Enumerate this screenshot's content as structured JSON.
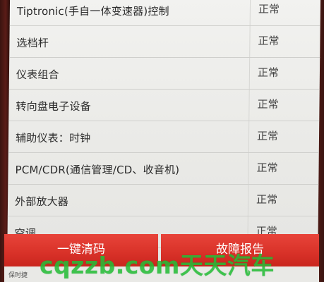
{
  "colors": {
    "screen_bg": "#ebebe8",
    "row_divider": "#cfcfcc",
    "button_red": "#d83128",
    "button_text": "#ffffff",
    "watermark_green": "#28c83c"
  },
  "system_list": {
    "items": [
      {
        "name": "Tiptronic(手自一体变速器)控制",
        "status": "正常"
      },
      {
        "name": "选档杆",
        "status": "正常"
      },
      {
        "name": "仪表组合",
        "status": "正常"
      },
      {
        "name": "转向盘电子设备",
        "status": "正常"
      },
      {
        "name": "辅助仪表：时钟",
        "status": "正常"
      },
      {
        "name": "PCM/CDR(通信管理/CD、收音机)",
        "status": "正常"
      },
      {
        "name": "外部放大器",
        "status": "正常"
      },
      {
        "name": "空调",
        "status": "正常"
      }
    ]
  },
  "actions": {
    "clear_codes_label": "一键清码",
    "fault_report_label": "故障报告"
  },
  "footer": {
    "small_text": "保时捷"
  },
  "watermark": {
    "text": "cqzzb.com天天汽车"
  }
}
